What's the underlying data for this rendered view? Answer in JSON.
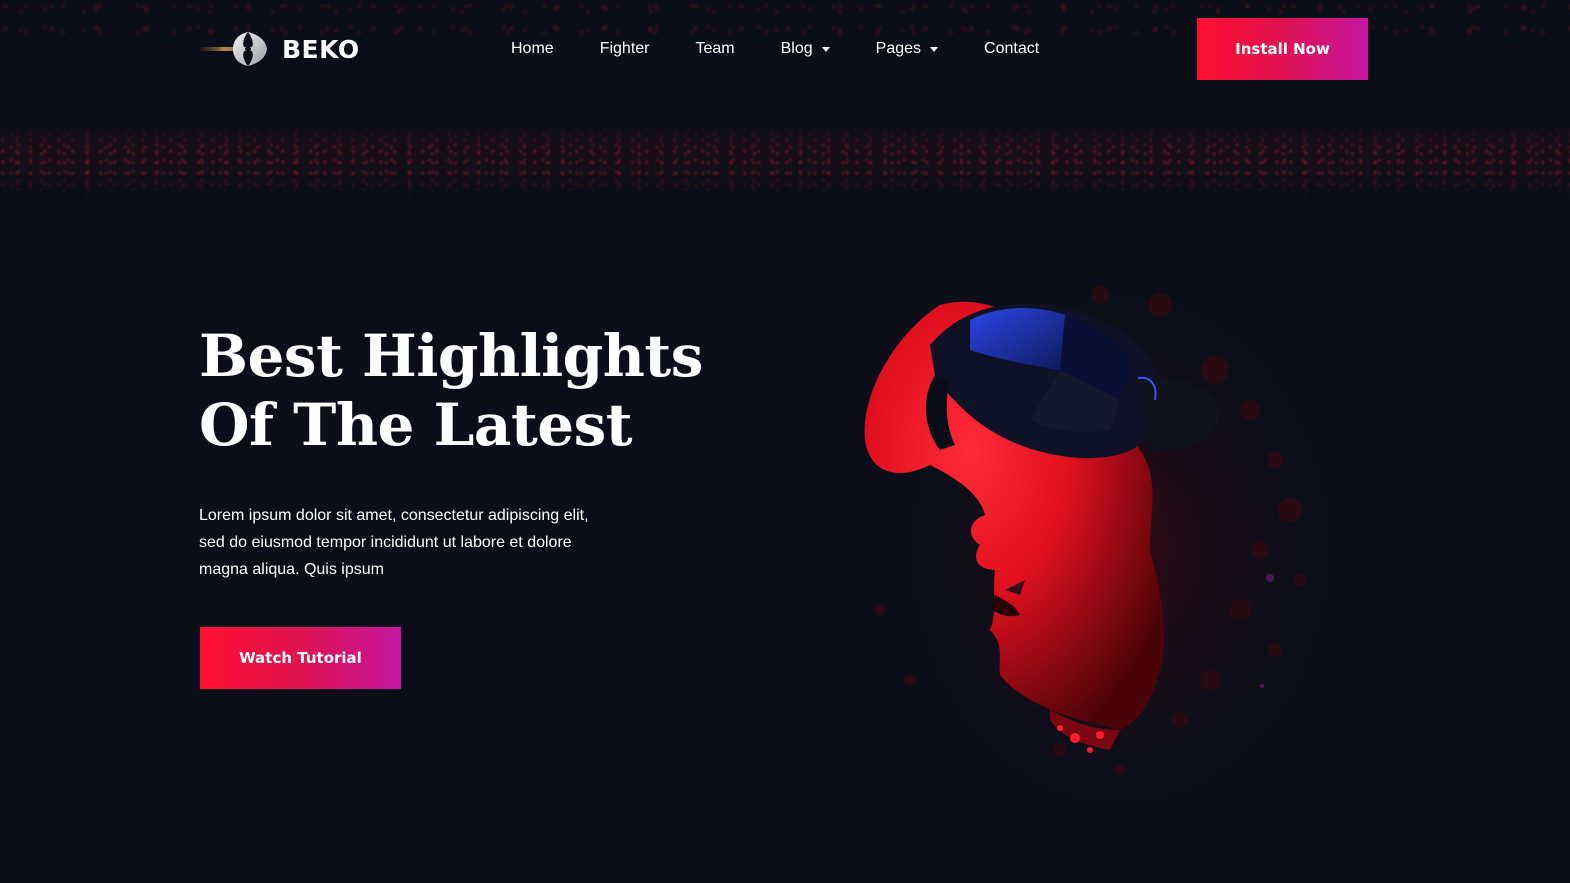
{
  "brand": {
    "name": "BEKO",
    "logo_icon": "axe-logo-icon"
  },
  "nav": {
    "items": [
      {
        "label": "Home",
        "has_dropdown": false
      },
      {
        "label": "Fighter",
        "has_dropdown": false
      },
      {
        "label": "Team",
        "has_dropdown": false
      },
      {
        "label": "Blog",
        "has_dropdown": true
      },
      {
        "label": "Pages",
        "has_dropdown": true
      },
      {
        "label": "Contact",
        "has_dropdown": false
      }
    ]
  },
  "header": {
    "cta_label": "Install Now"
  },
  "hero": {
    "title_line1": "Best Highlights",
    "title_line2": "Of The Latest",
    "text_line1": "Lorem ipsum dolor sit amet, consectetur adipiscing elit,",
    "text_line2": "sed do eiusmod tempor incididunt ut labore et dolore",
    "text_line3": "magna aliqua. Quis ipsum",
    "cta_label": "Watch Tutorial",
    "image": "vr-headset-gamer-icon"
  },
  "colors": {
    "background": "#0b0e18",
    "gradient_start": "#ff0f2f",
    "gradient_end": "#c516a0",
    "accent_red": "#ff1a2e",
    "headset_blue": "#1d3fd1"
  }
}
